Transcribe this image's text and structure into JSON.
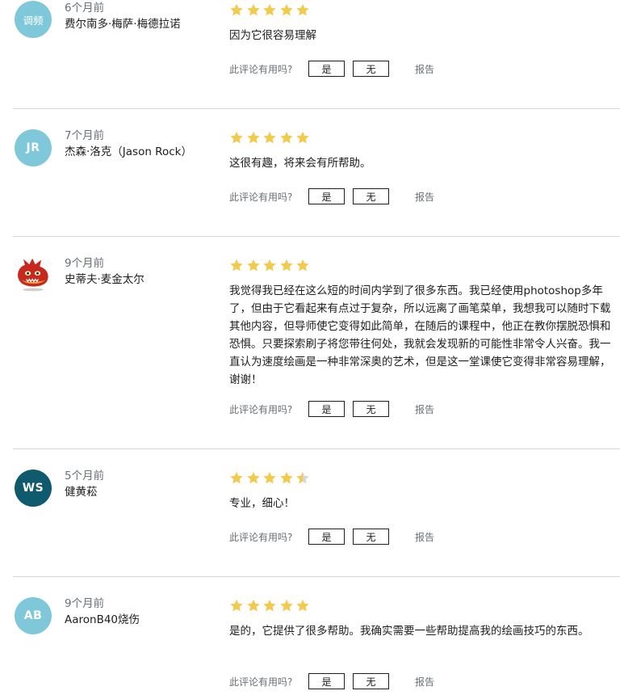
{
  "colors": {
    "star": "#f3ca4d",
    "star_empty": "#d1d7dc",
    "avatar_light": "#7ec8d9",
    "avatar_dark": "#0f5a6c"
  },
  "helpful_prompt": "此评论有用吗?",
  "yes_label": "是",
  "no_label": "无",
  "report_label": "报告",
  "reviews": [
    {
      "avatar_text": "调频",
      "time": "6个月前",
      "name": "费尔南多·梅萨·梅德拉诺",
      "rating": 5,
      "text": "因为它很容易理解"
    },
    {
      "avatar_text": "JR",
      "time": "7个月前",
      "name": "杰森·洛克（Jason Rock）",
      "rating": 5,
      "text": "这很有趣，将来会有所帮助。"
    },
    {
      "avatar_text": "",
      "time": "9个月前",
      "name": "史蒂夫·麦金太尔",
      "rating": 5,
      "text": "我觉得我已经在这么短的时间内学到了很多东西。我已经使用photoshop多年了，但由于它看起来有点过于复杂，所以远离了画笔菜单，我想我可以随时下载其他内容，但导师使它变得如此简单，在随后的课程中，他正在教你摆脱恐惧和恐惧。只要探索刷子将您带往何处，我就会发现新的可能性非常令人兴奋。我一直认为速度绘画是一种非常深奥的艺术，但是这一堂课使它变得非常容易理解，谢谢！"
    },
    {
      "avatar_text": "WS",
      "time": "5个月前",
      "name": "健黄菘",
      "rating": 4.5,
      "text": "专业，细心！"
    },
    {
      "avatar_text": "AB",
      "time": "9个月前",
      "name": "AaronB40烧伤",
      "rating": 5,
      "text": "是的，它提供了很多帮助。我确实需要一些帮助提高我的绘画技巧的东西。"
    }
  ]
}
